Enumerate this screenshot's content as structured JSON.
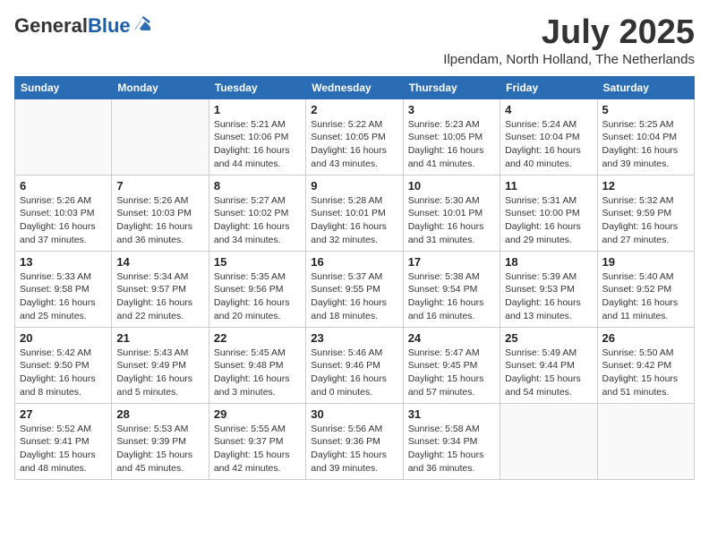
{
  "header": {
    "logo_general": "General",
    "logo_blue": "Blue",
    "month": "July 2025",
    "location": "Ilpendam, North Holland, The Netherlands"
  },
  "days_of_week": [
    "Sunday",
    "Monday",
    "Tuesday",
    "Wednesday",
    "Thursday",
    "Friday",
    "Saturday"
  ],
  "weeks": [
    [
      {
        "day": "",
        "info": ""
      },
      {
        "day": "",
        "info": ""
      },
      {
        "day": "1",
        "sunrise": "5:21 AM",
        "sunset": "10:06 PM",
        "daylight": "16 hours and 44 minutes."
      },
      {
        "day": "2",
        "sunrise": "5:22 AM",
        "sunset": "10:05 PM",
        "daylight": "16 hours and 43 minutes."
      },
      {
        "day": "3",
        "sunrise": "5:23 AM",
        "sunset": "10:05 PM",
        "daylight": "16 hours and 41 minutes."
      },
      {
        "day": "4",
        "sunrise": "5:24 AM",
        "sunset": "10:04 PM",
        "daylight": "16 hours and 40 minutes."
      },
      {
        "day": "5",
        "sunrise": "5:25 AM",
        "sunset": "10:04 PM",
        "daylight": "16 hours and 39 minutes."
      }
    ],
    [
      {
        "day": "6",
        "sunrise": "5:26 AM",
        "sunset": "10:03 PM",
        "daylight": "16 hours and 37 minutes."
      },
      {
        "day": "7",
        "sunrise": "5:26 AM",
        "sunset": "10:03 PM",
        "daylight": "16 hours and 36 minutes."
      },
      {
        "day": "8",
        "sunrise": "5:27 AM",
        "sunset": "10:02 PM",
        "daylight": "16 hours and 34 minutes."
      },
      {
        "day": "9",
        "sunrise": "5:28 AM",
        "sunset": "10:01 PM",
        "daylight": "16 hours and 32 minutes."
      },
      {
        "day": "10",
        "sunrise": "5:30 AM",
        "sunset": "10:01 PM",
        "daylight": "16 hours and 31 minutes."
      },
      {
        "day": "11",
        "sunrise": "5:31 AM",
        "sunset": "10:00 PM",
        "daylight": "16 hours and 29 minutes."
      },
      {
        "day": "12",
        "sunrise": "5:32 AM",
        "sunset": "9:59 PM",
        "daylight": "16 hours and 27 minutes."
      }
    ],
    [
      {
        "day": "13",
        "sunrise": "5:33 AM",
        "sunset": "9:58 PM",
        "daylight": "16 hours and 25 minutes."
      },
      {
        "day": "14",
        "sunrise": "5:34 AM",
        "sunset": "9:57 PM",
        "daylight": "16 hours and 22 minutes."
      },
      {
        "day": "15",
        "sunrise": "5:35 AM",
        "sunset": "9:56 PM",
        "daylight": "16 hours and 20 minutes."
      },
      {
        "day": "16",
        "sunrise": "5:37 AM",
        "sunset": "9:55 PM",
        "daylight": "16 hours and 18 minutes."
      },
      {
        "day": "17",
        "sunrise": "5:38 AM",
        "sunset": "9:54 PM",
        "daylight": "16 hours and 16 minutes."
      },
      {
        "day": "18",
        "sunrise": "5:39 AM",
        "sunset": "9:53 PM",
        "daylight": "16 hours and 13 minutes."
      },
      {
        "day": "19",
        "sunrise": "5:40 AM",
        "sunset": "9:52 PM",
        "daylight": "16 hours and 11 minutes."
      }
    ],
    [
      {
        "day": "20",
        "sunrise": "5:42 AM",
        "sunset": "9:50 PM",
        "daylight": "16 hours and 8 minutes."
      },
      {
        "day": "21",
        "sunrise": "5:43 AM",
        "sunset": "9:49 PM",
        "daylight": "16 hours and 5 minutes."
      },
      {
        "day": "22",
        "sunrise": "5:45 AM",
        "sunset": "9:48 PM",
        "daylight": "16 hours and 3 minutes."
      },
      {
        "day": "23",
        "sunrise": "5:46 AM",
        "sunset": "9:46 PM",
        "daylight": "16 hours and 0 minutes."
      },
      {
        "day": "24",
        "sunrise": "5:47 AM",
        "sunset": "9:45 PM",
        "daylight": "15 hours and 57 minutes."
      },
      {
        "day": "25",
        "sunrise": "5:49 AM",
        "sunset": "9:44 PM",
        "daylight": "15 hours and 54 minutes."
      },
      {
        "day": "26",
        "sunrise": "5:50 AM",
        "sunset": "9:42 PM",
        "daylight": "15 hours and 51 minutes."
      }
    ],
    [
      {
        "day": "27",
        "sunrise": "5:52 AM",
        "sunset": "9:41 PM",
        "daylight": "15 hours and 48 minutes."
      },
      {
        "day": "28",
        "sunrise": "5:53 AM",
        "sunset": "9:39 PM",
        "daylight": "15 hours and 45 minutes."
      },
      {
        "day": "29",
        "sunrise": "5:55 AM",
        "sunset": "9:37 PM",
        "daylight": "15 hours and 42 minutes."
      },
      {
        "day": "30",
        "sunrise": "5:56 AM",
        "sunset": "9:36 PM",
        "daylight": "15 hours and 39 minutes."
      },
      {
        "day": "31",
        "sunrise": "5:58 AM",
        "sunset": "9:34 PM",
        "daylight": "15 hours and 36 minutes."
      },
      {
        "day": "",
        "info": ""
      },
      {
        "day": "",
        "info": ""
      }
    ]
  ],
  "labels": {
    "sunrise": "Sunrise:",
    "sunset": "Sunset:",
    "daylight": "Daylight:"
  }
}
